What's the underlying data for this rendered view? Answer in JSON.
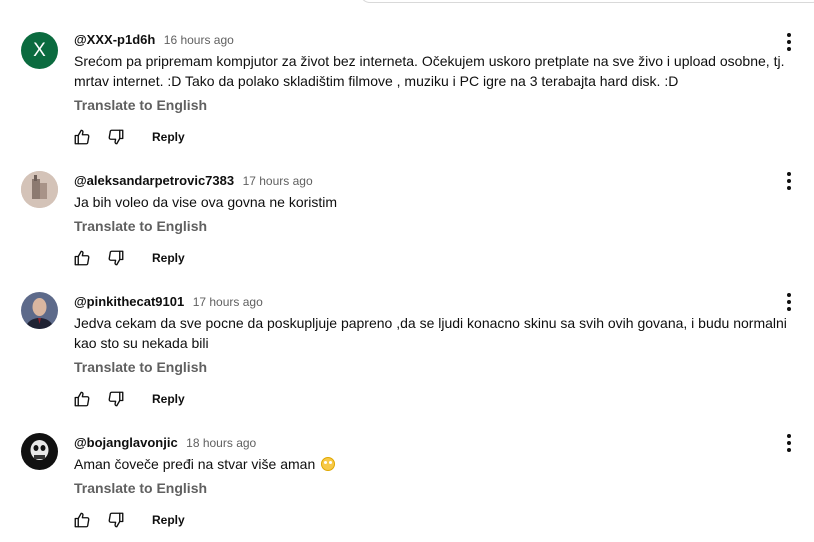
{
  "translate_label": "Translate to English",
  "reply_label": "Reply",
  "comments": [
    {
      "author": "@XXX-p1d6h",
      "time": "16 hours ago",
      "avatar_letter": "X",
      "text": "Srećom pa pripremam kompjutor za život bez interneta. Očekujem uskoro pretplate na sve živo i upload osobne, tj. mrtav internet. :D Tako da polako skladištim filmove , muziku i PC igre na 3 terabajta hard disk. :D"
    },
    {
      "author": "@aleksandarpetrovic7383",
      "time": "17 hours ago",
      "text": "Ja bih voleo da vise ova govna ne koristim"
    },
    {
      "author": "@pinkithecat9101",
      "time": "17 hours ago",
      "text": "Jedva cekam da sve pocne da poskupljuje papreno ,da se ljudi konacno skinu sa svih ovih govana, i budu normalni kao sto su nekada bili"
    },
    {
      "author": "@bojanglavonjic",
      "time": "18 hours ago",
      "text": "Aman čoveče pređi na stvar više aman",
      "emoji": "face-with-rolling-eyes"
    }
  ]
}
